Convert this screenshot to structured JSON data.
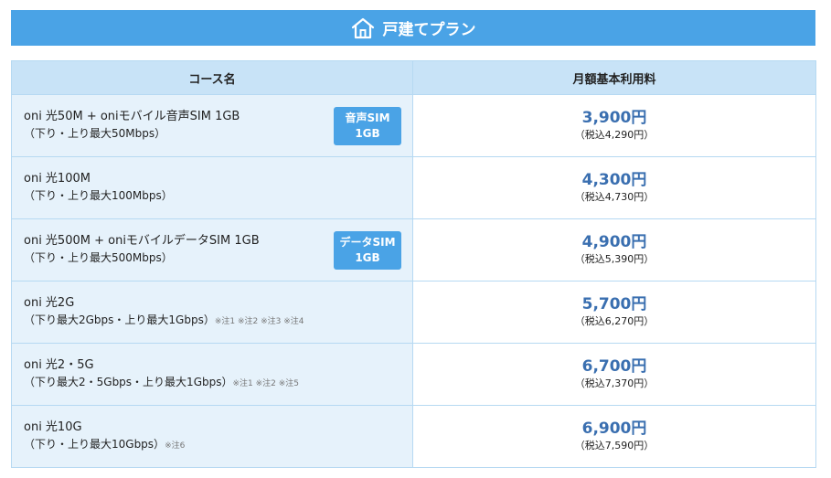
{
  "banner": {
    "title": "戸建てプラン",
    "icon": "house-icon"
  },
  "table": {
    "headers": [
      "コース名",
      "月額基本利用料"
    ],
    "rows": [
      {
        "name": "oni 光50M + oniモバイル音声SIM 1GB",
        "speed": "（下り・上り最大50Mbps）",
        "notes": "",
        "badge": [
          "音声SIM",
          "1GB"
        ],
        "price": "3,900円",
        "tax": "（税込4,290円）"
      },
      {
        "name": "oni 光100M",
        "speed": "（下り・上り最大100Mbps）",
        "notes": "",
        "badge": null,
        "price": "4,300円",
        "tax": "（税込4,730円）"
      },
      {
        "name": "oni 光500M + oniモバイルデータSIM 1GB",
        "speed": "（下り・上り最大500Mbps）",
        "notes": "",
        "badge": [
          "データSIM",
          "1GB"
        ],
        "price": "4,900円",
        "tax": "（税込5,390円）"
      },
      {
        "name": "oni 光2G",
        "speed": "（下り最大2Gbps・上り最大1Gbps）",
        "notes": "※注1 ※注2 ※注3 ※注4",
        "badge": null,
        "price": "5,700円",
        "tax": "（税込6,270円）"
      },
      {
        "name": "oni 光2・5G",
        "speed": "（下り最大2・5Gbps・上り最大1Gbps）",
        "notes": "※注1 ※注2 ※注5",
        "badge": null,
        "price": "6,700円",
        "tax": "（税込7,370円）"
      },
      {
        "name": "oni 光10G",
        "speed": "（下り・上り最大10Gbps）",
        "notes": "※注6",
        "badge": null,
        "price": "6,900円",
        "tax": "（税込7,590円）"
      }
    ]
  }
}
